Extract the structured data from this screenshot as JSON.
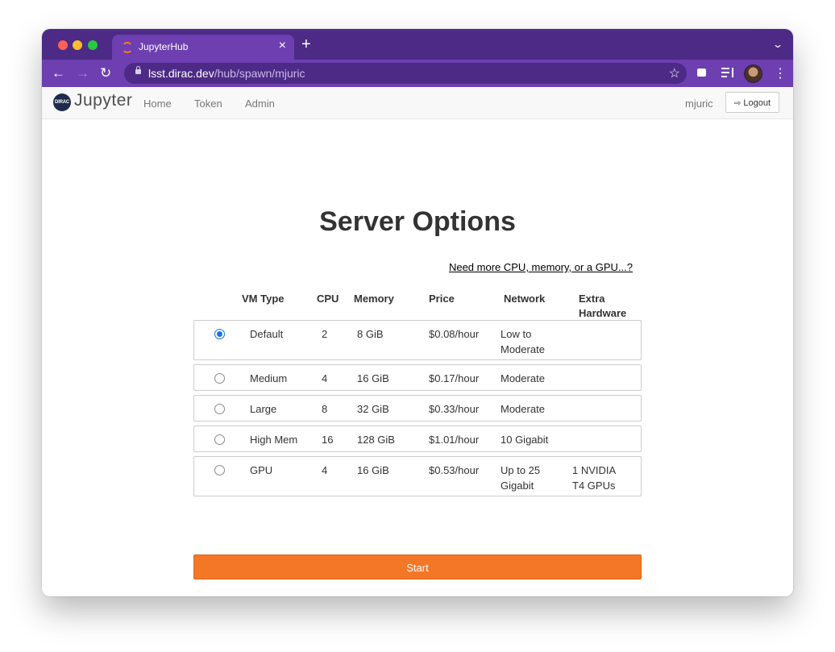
{
  "browser": {
    "tab_title": "JupyterHub",
    "tab_close": "×",
    "new_tab": "+",
    "tabs_menu": "⌄",
    "url_host": "lsst.dirac.dev",
    "url_path": "/hub/spawn/mjuric",
    "back_icon": "←",
    "forward_icon": "→",
    "reload_icon": "↻",
    "star_icon": "☆",
    "menu_icon": "⋮"
  },
  "navbar": {
    "logo_badge": "DIRAC",
    "logo_text": "Jupyter",
    "links": [
      "Home",
      "Token",
      "Admin"
    ],
    "username": "mjuric",
    "logout_icon": "⇨",
    "logout_label": "Logout"
  },
  "page": {
    "title": "Server Options",
    "help_link": "Need more CPU, memory, or a GPU...?",
    "start_label": "Start"
  },
  "table": {
    "headers": {
      "vm_type": "VM Type",
      "cpu": "CPU",
      "memory": "Memory",
      "price": "Price",
      "network": "Network",
      "hardware": "Extra Hardware"
    },
    "rows": [
      {
        "vm_type": "Default",
        "cpu": "2",
        "memory": "8 GiB",
        "price": "$0.08/hour",
        "network": "Low to Moderate",
        "hardware": "",
        "selected": true
      },
      {
        "vm_type": "Medium",
        "cpu": "4",
        "memory": "16 GiB",
        "price": "$0.17/hour",
        "network": "Moderate",
        "hardware": "",
        "selected": false
      },
      {
        "vm_type": "Large",
        "cpu": "8",
        "memory": "32 GiB",
        "price": "$0.33/hour",
        "network": "Moderate",
        "hardware": "",
        "selected": false
      },
      {
        "vm_type": "High Mem",
        "cpu": "16",
        "memory": "128 GiB",
        "price": "$1.01/hour",
        "network": "10 Gigabit",
        "hardware": "",
        "selected": false
      },
      {
        "vm_type": "GPU",
        "cpu": "4",
        "memory": "16 GiB",
        "price": "$0.53/hour",
        "network": "Up to 25 Gigabit",
        "hardware": "1 NVIDIA T4 GPUs",
        "selected": false
      }
    ]
  },
  "colors": {
    "chrome_dark": "#4c2a86",
    "chrome_light": "#6d3fb0",
    "accent": "#f37726",
    "radio_selected": "#1a73e8"
  }
}
